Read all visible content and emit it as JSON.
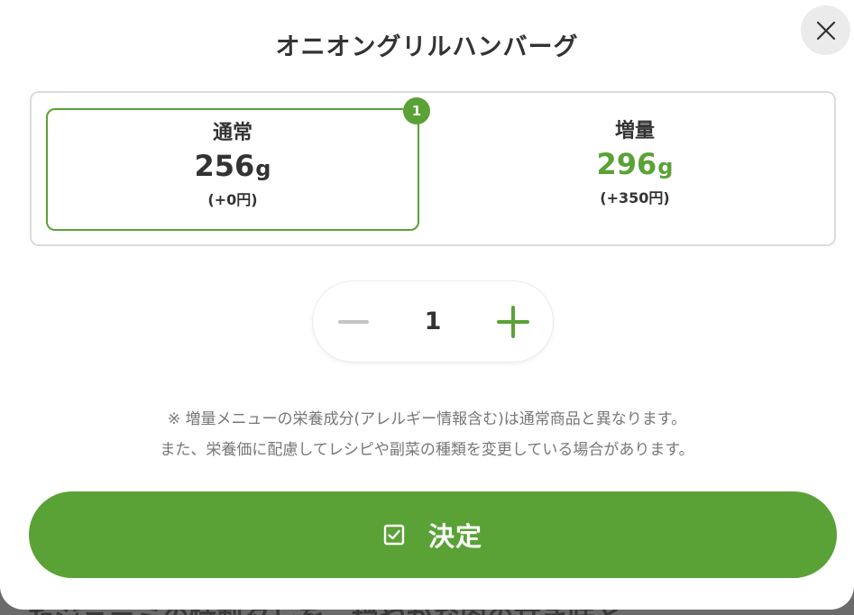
{
  "background": {
    "partial_text": "たジェラミの特製タレを…穏やかな肉の甘き味と…"
  },
  "modal": {
    "title": "オニオングリルハンバーグ",
    "close_icon": "close-icon"
  },
  "size_options": [
    {
      "label": "通常",
      "weight": "256",
      "unit": "g",
      "price": "(+0円)",
      "selected": true,
      "badge": "1"
    },
    {
      "label": "増量",
      "weight": "296",
      "unit": "g",
      "price": "(+350円)",
      "selected": false
    }
  ],
  "stepper": {
    "quantity": "1",
    "minus_icon": "minus-icon",
    "plus_icon": "plus-icon"
  },
  "notice": {
    "line1": "※ 増量メニューの栄養成分(アレルギー情報含む)は通常商品と異なります。",
    "line2": "また、栄養価に配慮してレシピや副菜の種類を変更している場合があります。"
  },
  "confirm": {
    "label": "決定",
    "icon": "checkbox-icon"
  },
  "colors": {
    "accent": "#5aa136",
    "text": "#333333",
    "muted": "#777777",
    "border": "#dcdcdc"
  }
}
